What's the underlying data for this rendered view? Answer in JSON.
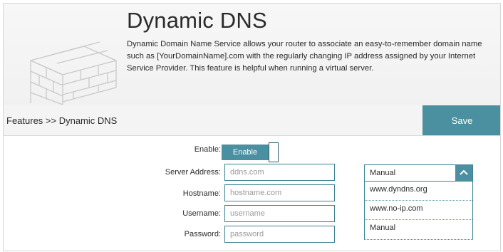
{
  "header": {
    "title": "Dynamic DNS",
    "description": "Dynamic Domain Name Service allows your router to associate an easy-to-remember domain name such as [YourDomainName].com with the regularly changing IP address assigned by your Internet Service Provider. This feature is helpful when running a virtual server."
  },
  "toolbar": {
    "breadcrumb": "Features >> Dynamic DNS",
    "save_label": "Save"
  },
  "form": {
    "enable_label": "Enable:",
    "enable_toggle_label": "Enable",
    "enable_state": true,
    "server_address_label": "Server Address:",
    "server_address_placeholder": "ddns.com",
    "hostname_label": "Hostname:",
    "hostname_placeholder": "hostname.com",
    "username_label": "Username:",
    "username_placeholder": "username",
    "password_label": "Password:",
    "password_placeholder": "password"
  },
  "server_dropdown": {
    "selected": "Manual",
    "options": [
      "www.dyndns.org",
      "www.no-ip.com",
      "Manual"
    ]
  },
  "colors": {
    "accent": "#4a90a0",
    "border_accent": "#3d8294",
    "header_bg": "#f4f4f4"
  },
  "icons": {
    "header_illustration": "brick-wall-icon",
    "dropdown_toggle": "chevron-up-icon"
  }
}
